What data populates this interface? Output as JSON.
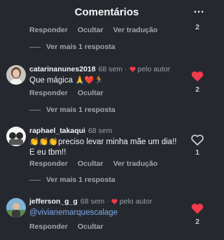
{
  "header": {
    "title": "Comentários",
    "more_icon": "…"
  },
  "labels": {
    "reply": "Responder",
    "hide": "Ocultar",
    "see_translation": "Ver tradução",
    "view_more": "Ver mais 1 resposta",
    "by_author": "pelo autor"
  },
  "colors": {
    "background": "#25292f",
    "like_red": "#f23a4d",
    "muted": "#a0a5ad",
    "mention": "#7fa8e8"
  },
  "top": {
    "count": "2"
  },
  "comments": [
    {
      "username": "catarinanunes2018",
      "time": "68 sem",
      "liked_by_author": true,
      "text_main": "Que mágica",
      "text_emoji": "🙏❤️🏃",
      "likes": "2",
      "liked": true
    },
    {
      "username": "raphael_takaqui",
      "time": "68 sem",
      "liked_by_author": false,
      "text_emoji": "👏👏👏",
      "text_line1": "preciso levar minha mãe um dia!!",
      "text_line2": "E eu tbm!!",
      "likes": "1",
      "liked": false
    },
    {
      "username": "jefferson_g_g",
      "time": "68 sem",
      "liked_by_author": true,
      "text_mention": "@vivianemarquescalage",
      "likes": "2",
      "liked": true
    }
  ]
}
